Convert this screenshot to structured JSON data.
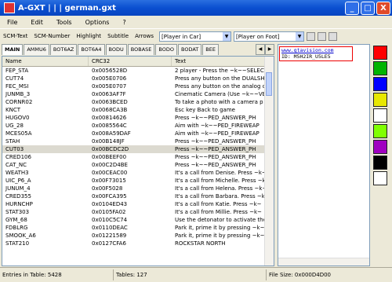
{
  "window": {
    "title": "A-GXT | | |  german.gxt",
    "minimize": "_",
    "maximize": "□",
    "close": "X"
  },
  "menu": [
    "File",
    "Edit",
    "Tools",
    "Options",
    "?"
  ],
  "toolbar": {
    "buttons": [
      "SCM-Text",
      "SCM-Number",
      "Highlight",
      "Subtitle",
      "Arrows"
    ],
    "combo1": "[Player in Car]",
    "combo2": "[Player on Foot]"
  },
  "tabs": [
    "MAIN",
    "AMMU6",
    "BOT6AZ",
    "BOT6A4",
    "BODU",
    "BOBASE",
    "BODO",
    "BODAT",
    "BEE"
  ],
  "table": {
    "headers": [
      "Name",
      "CRC32",
      "Text"
    ],
    "rows": [
      [
        "FEP_STA",
        "0x0056528D",
        "2 player - Press the ~k~~SELECT"
      ],
      [
        "CUT74",
        "0x005E0706",
        "Press any button on the DUALSH"
      ],
      [
        "FEC_MSI",
        "0x005E0707",
        "Press any button on the analog co"
      ],
      [
        "JUNMB_3",
        "0x0063AF7F",
        "Cinematic Camera (Use ~k~~VE"
      ],
      [
        "CORNR02",
        "0x0063BCED",
        "To take a photo with a camera p"
      ],
      [
        "KNCT",
        "0x0068CA3B",
        "Esc key Back to game"
      ],
      [
        "HUGOV0",
        "0x00814626",
        "Press ~k~~PED_ANSWER_PH"
      ],
      [
        "UG_28",
        "0x0085564C",
        "Aim with ~k~~PED_FIREWEAP"
      ],
      [
        "MCES05A",
        "0x008A59DAF",
        "Aim with ~k~~PED_FIREWEAP"
      ],
      [
        "STAH",
        "0x00B148JF",
        "Press ~k~~PED_ANSWER_PH"
      ],
      [
        "CUT03",
        "0x00BCDC2D",
        "Press ~k~~PED_ANSWER_PH"
      ],
      [
        "CRED106",
        "0x00BEEF00",
        "Press ~k~~PED_ANSWER_PH"
      ],
      [
        "CAT_NC",
        "0x00C2D4BE",
        "Press ~k~~PED_ANSWER_PH"
      ],
      [
        "WEATH3",
        "0x00CEAC00",
        "It's a call from Denise. Press ~k~"
      ],
      [
        "UIC_P6_A",
        "0x00F73015",
        "It's a call from Michelle. Press ~k~"
      ],
      [
        "JUNUM_4",
        "0x00F5028",
        "It's a call from Helena. Press ~k~"
      ],
      [
        "CRED355",
        "0x00FCA395",
        "It's a call from Barbara. Press ~k~"
      ],
      [
        "HURNCHP",
        "0x0104ED43",
        "It's a call from Katie. Press ~k~"
      ],
      [
        "STAT303",
        "0x0105FA02",
        "It's a call from Millie. Press ~k~"
      ],
      [
        "GYM_68",
        "0x010C5C74",
        "Use the detonator to activate the"
      ],
      [
        "FDBLRG",
        "0x0110DEAC",
        "Park it, prime it by pressing ~k~"
      ],
      [
        "SMOOK_A6",
        "0x01221589",
        "Park it, prime it by pressing ~k~"
      ],
      [
        "STAT210",
        "0x0127CFA6",
        "ROCKSTAR NORTH"
      ]
    ]
  },
  "editor": {
    "lines": [
      "www.gtavision.com",
      "ID: M5H2IR_U5LE5"
    ]
  },
  "palette": [
    "#ff0000",
    "#00b400",
    "#0000ff",
    "#e8e800",
    "#ffffff",
    "#80ff00",
    "#a000c0",
    "#000000",
    "#ffffff"
  ],
  "status": {
    "entries": "Entries in Table: 5428",
    "tables": "Tables: 127",
    "filesize": "File Size: 0x000D4D00"
  }
}
